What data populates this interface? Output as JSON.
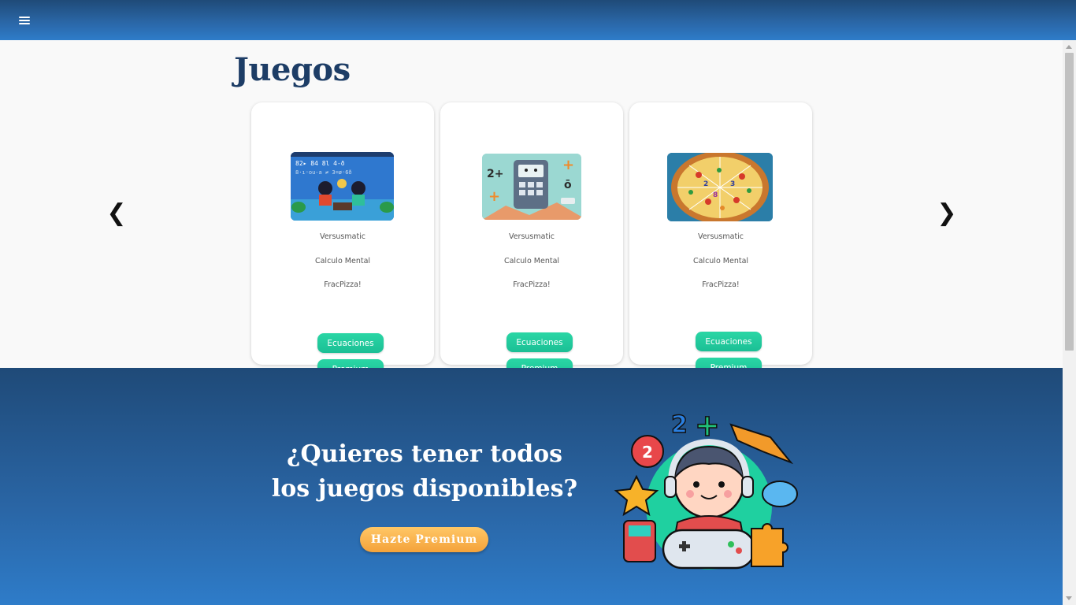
{
  "header": {
    "menu_icon": "hamburger-menu-icon"
  },
  "main": {
    "title": "Juegos",
    "prev_arrow": "❮",
    "next_arrow": "❯",
    "cards": [
      {
        "image": "versus-kids-math-game-image",
        "links": [
          "Versusmatic",
          "Calculo Mental",
          "FracPizza!"
        ],
        "tags": [
          "Ecuaciones",
          "Premium"
        ]
      },
      {
        "image": "calculator-character-image",
        "links": [
          "Versusmatic",
          "Calculo Mental",
          "FracPizza!"
        ],
        "tags": [
          "Ecuaciones",
          "Premium"
        ]
      },
      {
        "image": "fraction-pizza-image",
        "links": [
          "Versusmatic",
          "Calculo Mental",
          "FracPizza!"
        ],
        "tags": [
          "Ecuaciones",
          "Premium"
        ]
      }
    ]
  },
  "promo": {
    "title_line1": "¿Quieres tener todos",
    "title_line2": "los juegos disponibles?",
    "button_label": "Hazte Premium",
    "mascot_image": "gamer-kid-mascot-image"
  },
  "colors": {
    "header": "#2a66a6",
    "title": "#1d3d66",
    "tag": "#1fc99b",
    "premium": "#f7b04a"
  }
}
